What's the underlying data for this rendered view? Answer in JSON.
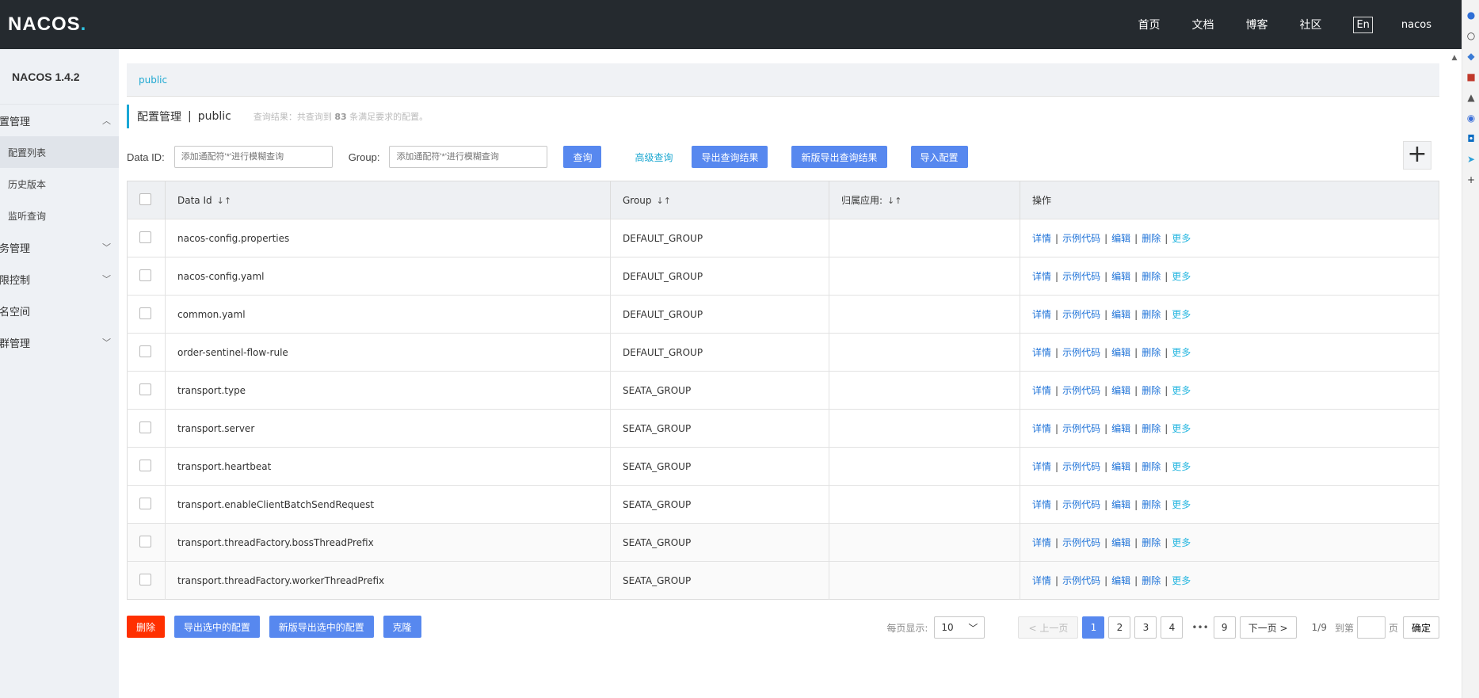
{
  "header": {
    "logo_main": "NACOS",
    "logo_dot": ".",
    "nav": [
      "首页",
      "文档",
      "博客",
      "社区"
    ],
    "lang": "En",
    "user": "nacos"
  },
  "sidebar": {
    "product": "NACOS 1.4.2",
    "menu": [
      {
        "type": "group",
        "label": "配置管理",
        "chev": "^"
      },
      {
        "type": "item",
        "label": "配置列表",
        "active": true
      },
      {
        "type": "item",
        "label": "历史版本"
      },
      {
        "type": "item",
        "label": "监听查询"
      },
      {
        "type": "group",
        "label": "服务管理",
        "chev": "v"
      },
      {
        "type": "group",
        "label": "权限控制",
        "chev": "v"
      },
      {
        "type": "group",
        "label": "命名空间",
        "chev": ""
      },
      {
        "type": "group",
        "label": "集群管理",
        "chev": "v"
      }
    ]
  },
  "breadcrumb": "public",
  "title": {
    "main": "配置管理",
    "sep": "|",
    "namespace": "public",
    "summary_pre": "查询结果：共查询到",
    "summary_count": "83",
    "summary_post": "条满足要求的配置。"
  },
  "search": {
    "dataid_label": "Data ID:",
    "dataid_placeholder": "添加通配符'*'进行模糊查询",
    "group_label": "Group:",
    "group_placeholder": "添加通配符'*'进行模糊查询",
    "query_btn": "查询",
    "advanced": "高级查询",
    "export_btn": "导出查询结果",
    "export_new_btn": "新版导出查询结果",
    "import_btn": "导入配置",
    "plus": "+"
  },
  "table": {
    "headers": [
      "Data Id",
      "Group",
      "归属应用:",
      "操作"
    ],
    "sort_icon": "↓↑",
    "ops": [
      "详情",
      "示例代码",
      "编辑",
      "删除",
      "更多"
    ],
    "rows": [
      {
        "dataId": "nacos-config.properties",
        "group": "DEFAULT_GROUP",
        "app": ""
      },
      {
        "dataId": "nacos-config.yaml",
        "group": "DEFAULT_GROUP",
        "app": ""
      },
      {
        "dataId": "common.yaml",
        "group": "DEFAULT_GROUP",
        "app": ""
      },
      {
        "dataId": "order-sentinel-flow-rule",
        "group": "DEFAULT_GROUP",
        "app": ""
      },
      {
        "dataId": "transport.type",
        "group": "SEATA_GROUP",
        "app": ""
      },
      {
        "dataId": "transport.server",
        "group": "SEATA_GROUP",
        "app": ""
      },
      {
        "dataId": "transport.heartbeat",
        "group": "SEATA_GROUP",
        "app": ""
      },
      {
        "dataId": "transport.enableClientBatchSendRequest",
        "group": "SEATA_GROUP",
        "app": ""
      },
      {
        "dataId": "transport.threadFactory.bossThreadPrefix",
        "group": "SEATA_GROUP",
        "app": ""
      },
      {
        "dataId": "transport.threadFactory.workerThreadPrefix",
        "group": "SEATA_GROUP",
        "app": ""
      }
    ]
  },
  "footer": {
    "delete_btn": "删除",
    "export_sel_btn": "导出选中的配置",
    "export_sel_new_btn": "新版导出选中的配置",
    "clone_btn": "克隆"
  },
  "pager": {
    "page_size_label": "每页显示:",
    "page_size": "10",
    "prev": "< 上一页",
    "pages": [
      "1",
      "2",
      "3",
      "4"
    ],
    "ellipsis": "•••",
    "last_page": "9",
    "next": "下一页 >",
    "info": "1/9",
    "goto_label": "到第",
    "page_unit": "页",
    "confirm": "确定",
    "current": "1"
  },
  "colors": {
    "header_bg": "#252a2f",
    "accent": "#5788ef",
    "link": "#1f73d8",
    "danger": "#ff3000"
  }
}
